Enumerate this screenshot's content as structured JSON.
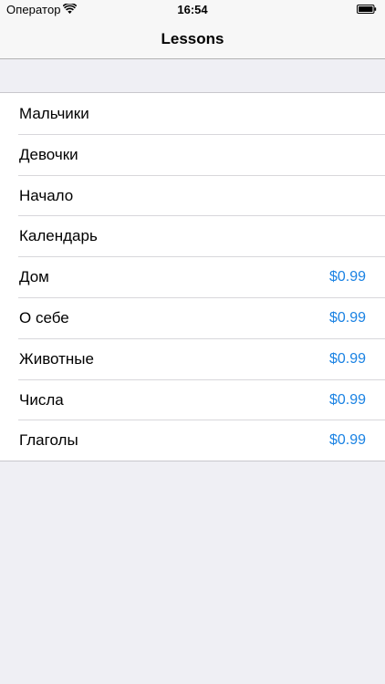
{
  "status_bar": {
    "carrier": "Оператор",
    "time": "16:54"
  },
  "nav_bar": {
    "title": "Lessons"
  },
  "lessons": [
    {
      "title": "Мальчики",
      "price": ""
    },
    {
      "title": "Девочки",
      "price": ""
    },
    {
      "title": "Начало",
      "price": ""
    },
    {
      "title": "Календарь",
      "price": ""
    },
    {
      "title": "Дом",
      "price": "$0.99"
    },
    {
      "title": "О себе",
      "price": "$0.99"
    },
    {
      "title": "Животные",
      "price": "$0.99"
    },
    {
      "title": "Числа",
      "price": "$0.99"
    },
    {
      "title": "Глаголы",
      "price": "$0.99"
    }
  ],
  "colors": {
    "accent": "#1a82e3",
    "background": "#efeff4",
    "bar": "#f7f7f7"
  },
  "icons": [
    "wifi-icon",
    "battery-icon"
  ]
}
